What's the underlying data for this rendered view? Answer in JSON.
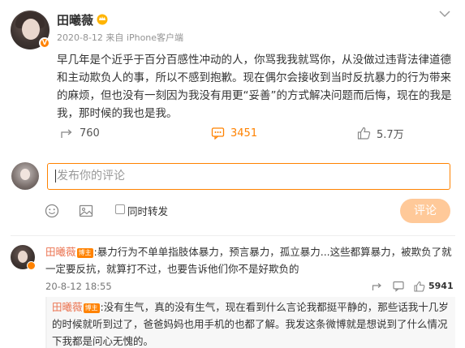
{
  "post": {
    "author": "田曦薇",
    "meta": "2020-8-12  来自 iPhone客户端",
    "body": "早几年是个近乎于百分百感性冲动的人，你骂我我就骂你，从没做过违背法律道德和主动欺负人的事，所以不感到抱歉。现在偶尔会接收到当时反抗暴力的行为带来的麻烦，但也没有一刻因为我没有用更“妥善”的方式解决问题而后悔，现在的我是我，那时候的我也是我。"
  },
  "actions": {
    "forward_count": "760",
    "comment_count": "3451",
    "like_count": "5.7万"
  },
  "composer": {
    "placeholder": "发布你的评论",
    "forward_label": "同时转发",
    "submit_label": "评论"
  },
  "comment": {
    "author": "田曦薇",
    "tag": "博主",
    "text": ":暴力行为不单单指肢体暴力，预言暴力，孤立暴力...这些都算暴力，被欺负了就一定要反抗，就算打不过，也要告诉他们你不是好欺负的",
    "date": "20-8-12 18:55",
    "like_count": "5941"
  },
  "reply": {
    "author": "田曦薇",
    "tag": "博主",
    "text": ":没有生气，真的没有生气，现在看到什么言论我都挺平静的，那些话我十几岁的时候就听到过了，爸爸妈妈也用手机的也都了解。我发这条微博就是想说到了什么情况下我都是问心无愧的。"
  },
  "colors": {
    "accent": "#ff8200",
    "name_link": "#eb7350",
    "submit_disabled": "#ffc999"
  }
}
